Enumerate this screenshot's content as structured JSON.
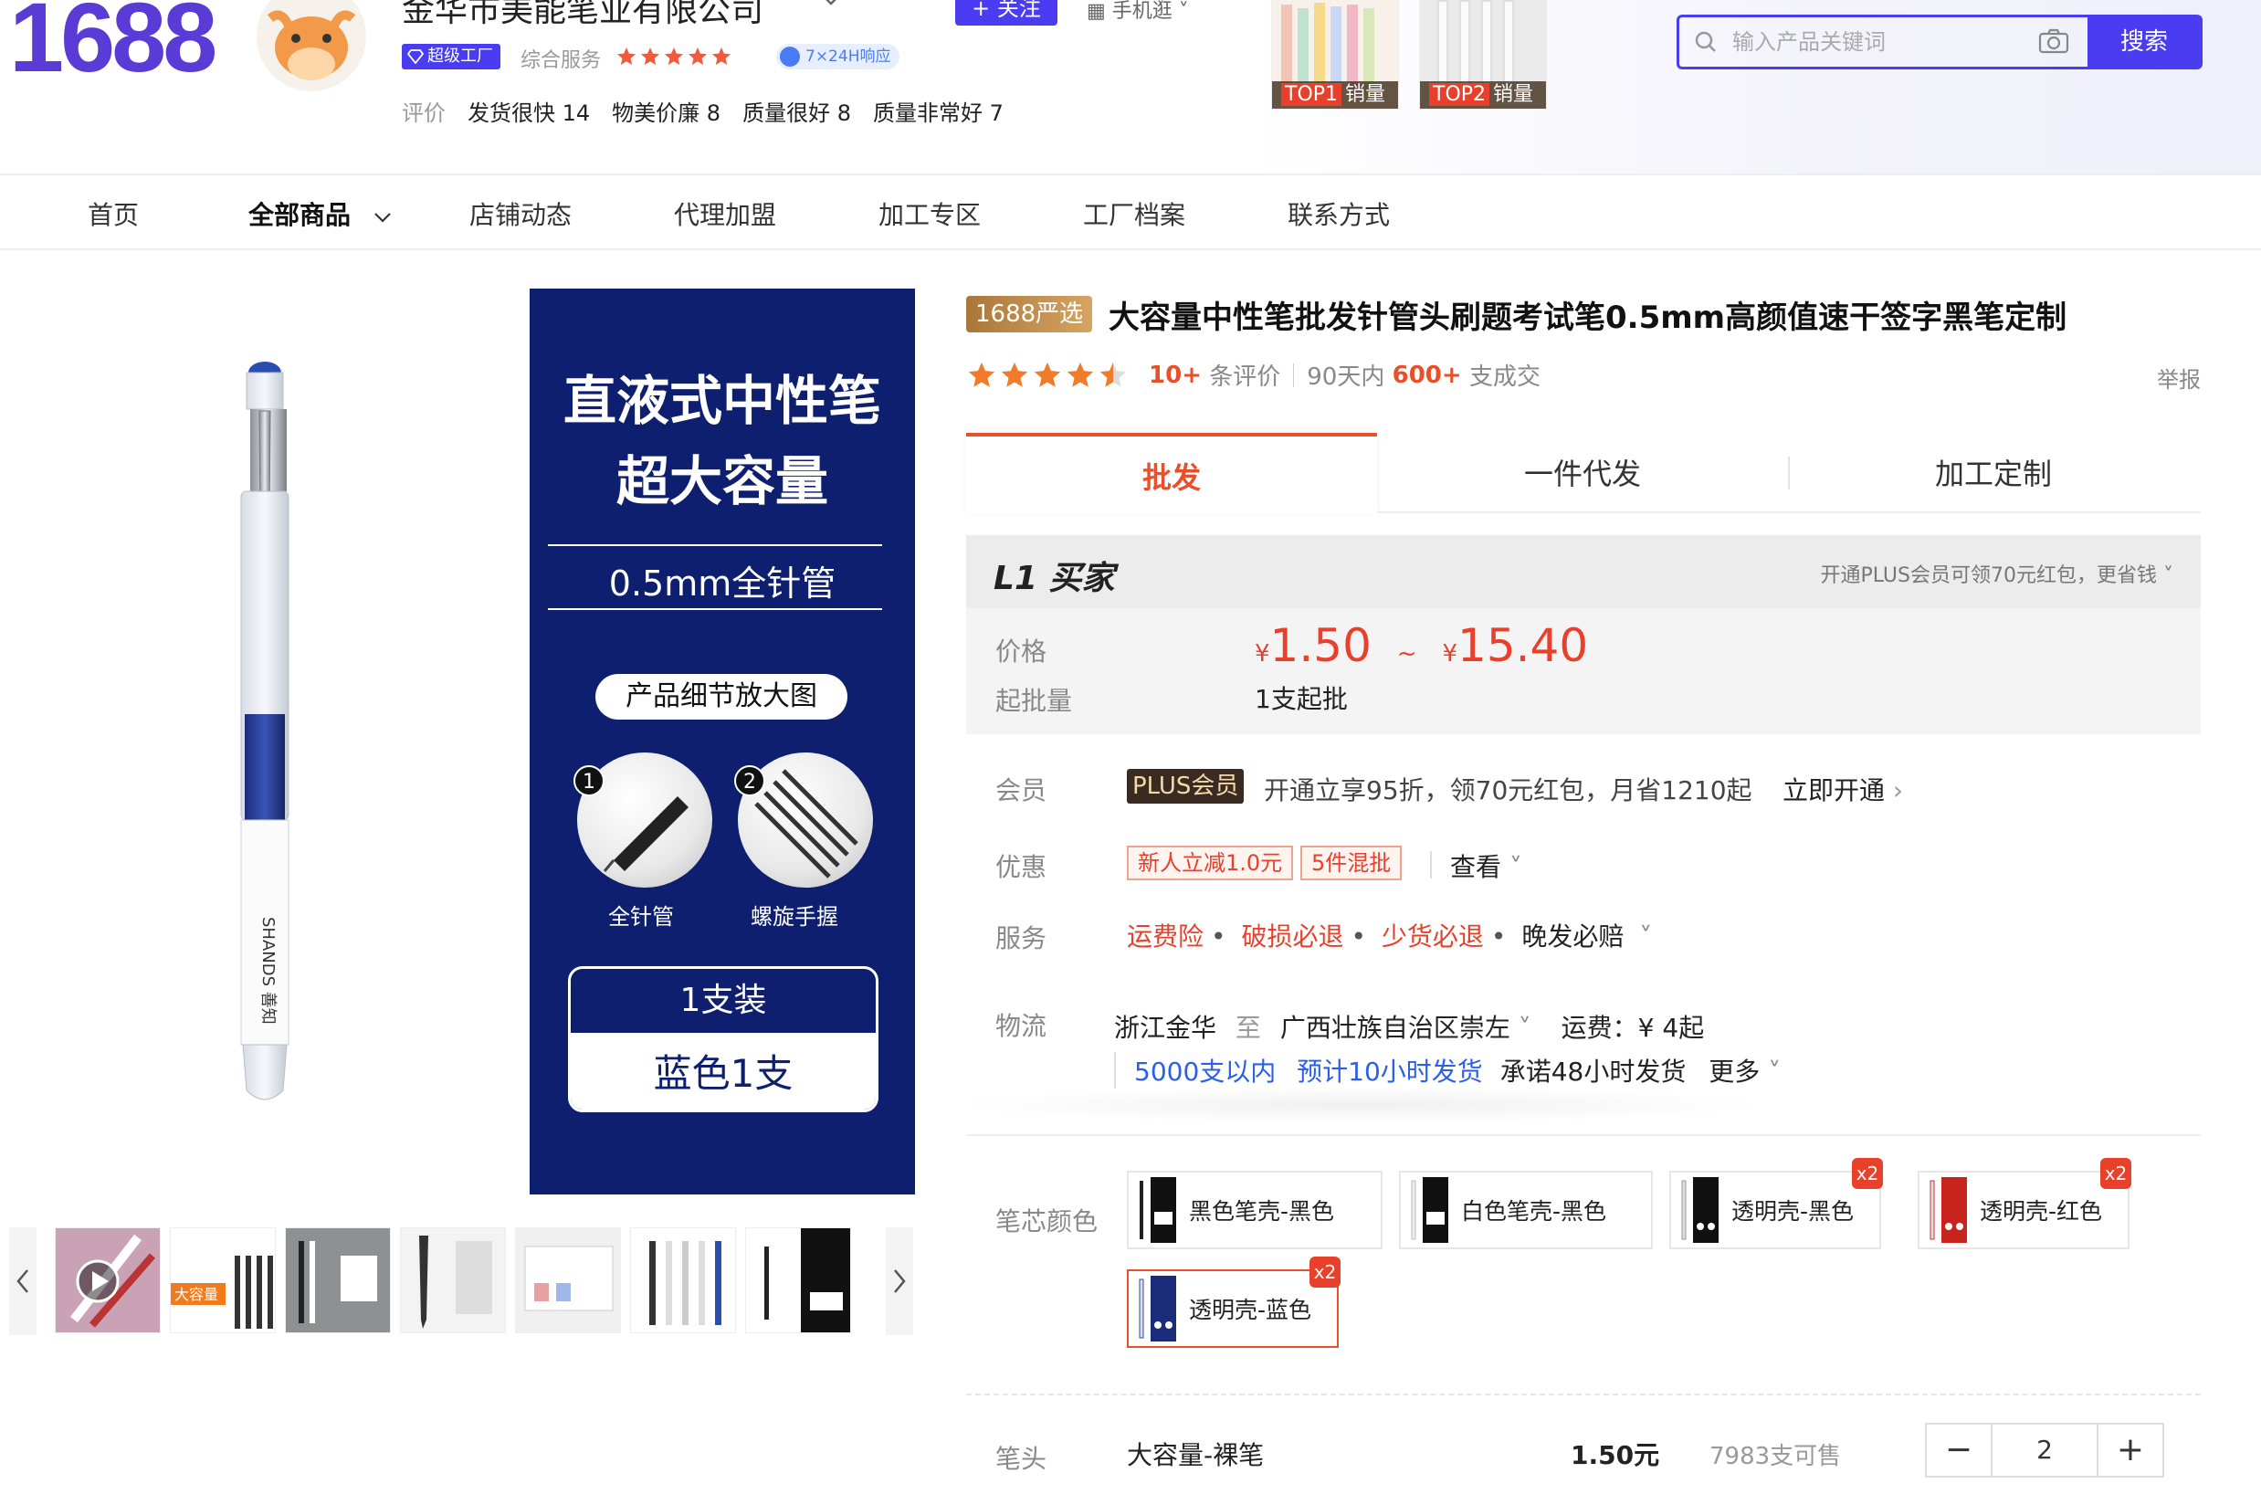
{
  "header": {
    "logo": "1688",
    "shop_name": "金华市美能笔业有限公司",
    "follow_label": "关注",
    "mobile_label": "手机逛",
    "super_factory_badge": "超级工厂",
    "composite_service_label": "综合服务",
    "composite_service_stars": 5,
    "response_badge": "7×24H响应",
    "eval_label": "评价",
    "eval_items": [
      "发货很快 14",
      "物美价廉 8",
      "质量很好 8",
      "质量非常好 7"
    ],
    "top_products": [
      {
        "rank": "TOP1",
        "label": "销量"
      },
      {
        "rank": "TOP2",
        "label": "销量"
      }
    ],
    "search": {
      "placeholder": "输入产品关键词",
      "button": "搜索"
    }
  },
  "nav": {
    "items": [
      "首页",
      "全部商品",
      "店铺动态",
      "代理加盟",
      "加工专区",
      "工厂档案",
      "联系方式"
    ],
    "active_index": 1
  },
  "gallery": {
    "promo": {
      "line1": "直液式中性笔",
      "line2": "超大容量",
      "line3": "0.5mm全针管",
      "pill": "产品细节放大图",
      "detail1_num": "1",
      "detail1_caption": "全针管",
      "detail2_num": "2",
      "detail2_caption": "螺旋手握",
      "box_top": "1支装",
      "box_bottom": "蓝色1支"
    },
    "pen_brand": "SHANDS 善知",
    "thumb2_text": "大容量"
  },
  "product": {
    "yanxuan_badge": "1688严选",
    "title": "大容量中性笔批发针管头刷题考试笔0.5mm高颜值速干签字黑笔定制",
    "rating_stars": 4.5,
    "review_count": "10+",
    "review_label": "条评价",
    "sales_prefix": "90天内",
    "sales_count": "600+",
    "sales_suffix": "支成交",
    "report": "举报",
    "tabs": [
      "批发",
      "一件代发",
      "加工定制"
    ],
    "active_tab": 0,
    "buyer_level": "L1 买家",
    "plus_hint": "开通PLUS会员可领70元红包，更省钱",
    "price_label": "价格",
    "price_currency": "¥",
    "price_low": "1.50",
    "price_sep": "~",
    "price_high": "15.40",
    "moq_label": "起批量",
    "moq": "1支起批",
    "member_label": "会员",
    "plus_badge": "PLUS会员",
    "plus_text": "开通立享95折，领70元红包，月省1210起",
    "plus_open": "立即开通",
    "discount_label": "优惠",
    "coupons": [
      "新人立减1.0元",
      "5件混批"
    ],
    "coupon_view": "查看",
    "service_label": "服务",
    "services": [
      "运费险",
      "破损必退",
      "少货必退"
    ],
    "service_extra": "晚发必赔",
    "logistics_label": "物流",
    "ship_from": "浙江金华",
    "ship_to_word": "至",
    "ship_to": "广西壮族自治区崇左",
    "ship_fee": "运费：¥ 4起",
    "ship_qty": "5000支以内",
    "ship_time": "预计10小时发货",
    "ship_promise": "承诺48小时发货",
    "ship_more": "更多",
    "color_label": "笔芯颜色",
    "skus": [
      {
        "label": "黑色笔壳-黑色",
        "badge": "",
        "selected": false
      },
      {
        "label": "白色笔壳-黑色",
        "badge": "",
        "selected": false
      },
      {
        "label": "透明壳-黑色",
        "badge": "x2",
        "selected": false
      },
      {
        "label": "透明壳-红色",
        "badge": "x2",
        "selected": false
      },
      {
        "label": "透明壳-蓝色",
        "badge": "x2",
        "selected": true
      }
    ],
    "tip_label": "笔头",
    "variant_name": "大容量-裸笔",
    "variant_price": "1.50元",
    "variant_stock": "7983支可售",
    "quantity": "2"
  },
  "colors": {
    "brand": "#5b3bd6",
    "accent": "#e8502b",
    "search": "#4a3cf0",
    "promo_bg": "#0d1f6e"
  }
}
